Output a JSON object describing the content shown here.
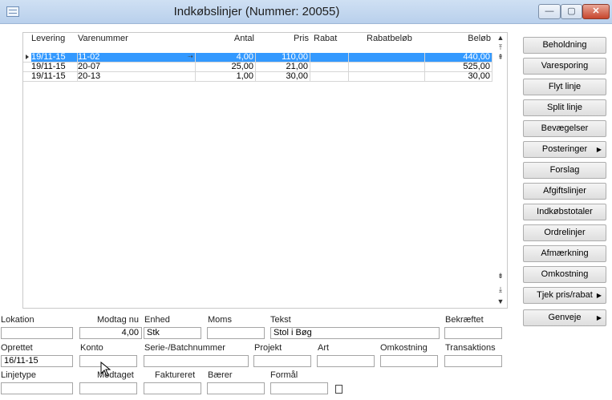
{
  "window": {
    "title": "Indkøbslinjer (Nummer: 20055)",
    "controls": {
      "minimize": "—",
      "maximize": "▢",
      "close": "✕"
    }
  },
  "grid": {
    "columns": [
      "Levering",
      "Varenummer",
      "Antal",
      "Pris",
      "Rabat",
      "Rabatbeløb",
      "Beløb"
    ],
    "rows": [
      {
        "levering": "19/11-15",
        "varenummer": "11-02",
        "antal": "4,00",
        "pris": "110,00",
        "rabat": "",
        "rabatbelob": "",
        "belob": "440,00",
        "selected": true
      },
      {
        "levering": "19/11-15",
        "varenummer": "20-07",
        "antal": "25,00",
        "pris": "21,00",
        "rabat": "",
        "rabatbelob": "",
        "belob": "525,00",
        "selected": false
      },
      {
        "levering": "19/11-15",
        "varenummer": "20-13",
        "antal": "1,00",
        "pris": "30,00",
        "rabat": "",
        "rabatbelob": "",
        "belob": "30,00",
        "selected": false
      }
    ]
  },
  "side_buttons": [
    {
      "label": "Beholdning",
      "submenu": false
    },
    {
      "label": "Varesporing",
      "submenu": false
    },
    {
      "label": "Flyt linje",
      "submenu": false
    },
    {
      "label": "Split linje",
      "submenu": false
    },
    {
      "label": "Bevægelser",
      "submenu": false
    },
    {
      "label": "Posteringer",
      "submenu": true
    },
    {
      "label": "Forslag",
      "submenu": false
    },
    {
      "label": "Afgiftslinjer",
      "submenu": false
    },
    {
      "label": "Indkøbstotaler",
      "submenu": false
    },
    {
      "label": "Ordrelinjer",
      "submenu": false
    },
    {
      "label": "Afmærkning",
      "submenu": false
    },
    {
      "label": "Omkostning",
      "submenu": false
    },
    {
      "label": "Tjek pris/rabat",
      "submenu": true
    },
    {
      "label": "Genveje",
      "submenu": true
    }
  ],
  "form": {
    "row1": {
      "lokation_label": "Lokation",
      "lokation_value": "",
      "modtag_nu_label": "Modtag nu",
      "modtag_nu_value": "4,00",
      "enhed_label": "Enhed",
      "enhed_value": "Stk",
      "moms_label": "Moms",
      "moms_value": "",
      "tekst_label": "Tekst",
      "tekst_value": "Stol i Bøg",
      "bekraeftet_label": "Bekræftet",
      "bekraeftet_value": ""
    },
    "row2": {
      "oprettet_label": "Oprettet",
      "oprettet_value": "16/11-15",
      "konto_label": "Konto",
      "konto_value": "",
      "serie_label": "Serie-/Batchnummer",
      "serie_value": "",
      "projekt_label": "Projekt",
      "projekt_value": "",
      "art_label": "Art",
      "art_value": "",
      "omkostning_label": "Omkostning",
      "omkostning_value": "",
      "transaktions_label": "Transaktions",
      "transaktions_value": ""
    },
    "row3": {
      "linjetype_label": "Linjetype",
      "linjetype_value": "",
      "modtaget_label": "Modtaget",
      "modtaget_value": "",
      "faktureret_label": "Faktureret",
      "faktureret_value": "",
      "baerer_label": "Bærer",
      "baerer_value": "",
      "formal_label": "Formål",
      "formal_value": ""
    }
  },
  "icons": {
    "row_marker": "row-pointer-icon",
    "lookup": "lookup-icon",
    "document": "document-icon",
    "scroll": [
      "scroll-up-icon",
      "scroll-top-icon",
      "scroll-bottom-icon",
      "scroll-down-icon"
    ]
  },
  "colors": {
    "selection": "#3399ff",
    "titlebar": "#c3d7ef",
    "close_button": "#c7452c"
  }
}
